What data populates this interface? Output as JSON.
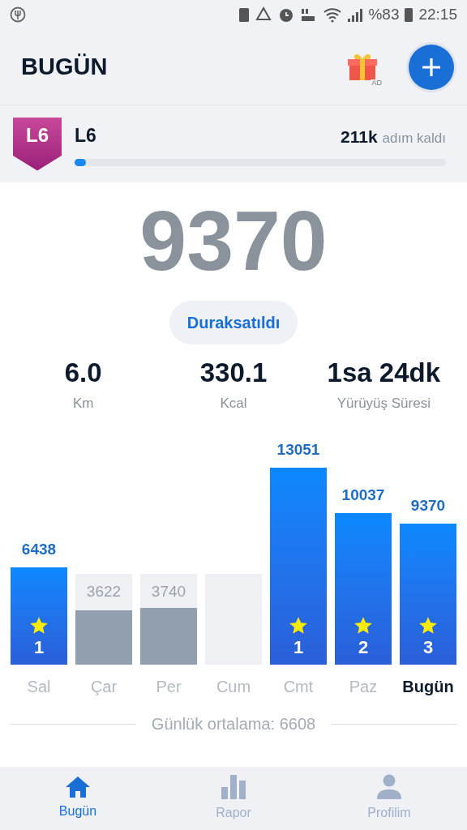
{
  "status_bar": {
    "battery_percent": "%83",
    "time": "22:15"
  },
  "header": {
    "title": "BUGÜN",
    "ad_label": "AD"
  },
  "level": {
    "badge": "L6",
    "name": "L6",
    "remaining_value": "211k",
    "remaining_label": "adım kaldı",
    "level": 0.03
  },
  "today": {
    "steps": "9370",
    "state_button": "Duraksatıldı"
  },
  "stats": [
    {
      "value": "6.0",
      "label": "Km"
    },
    {
      "value": "330.1",
      "label": "Kcal"
    },
    {
      "value": "1sa 24dk",
      "label": "Yürüyüş Süresi"
    }
  ],
  "days": [
    {
      "label": "Sal",
      "value": "6438",
      "kind": "met",
      "star_count": "1",
      "selected": false
    },
    {
      "label": "Çar",
      "value": "3622",
      "kind": "missed",
      "selected": false
    },
    {
      "label": "Per",
      "value": "3740",
      "kind": "missed",
      "selected": false
    },
    {
      "label": "Cum",
      "kind": "missed",
      "selected": false
    },
    {
      "label": "Cmt",
      "value": "13051",
      "kind": "met",
      "star_count": "1",
      "selected": false
    },
    {
      "label": "Paz",
      "value": "10037",
      "kind": "met",
      "star_count": "2",
      "selected": false
    },
    {
      "label": "Bugün",
      "value": "9370",
      "kind": "met",
      "star_count": "3",
      "selected": true
    }
  ],
  "average": "Günlük ortalama: 6608",
  "nav": [
    {
      "label": "Bugün",
      "selected": true
    },
    {
      "label": "Rapor",
      "selected": false
    },
    {
      "label": "Profilim",
      "selected": false
    }
  ]
}
